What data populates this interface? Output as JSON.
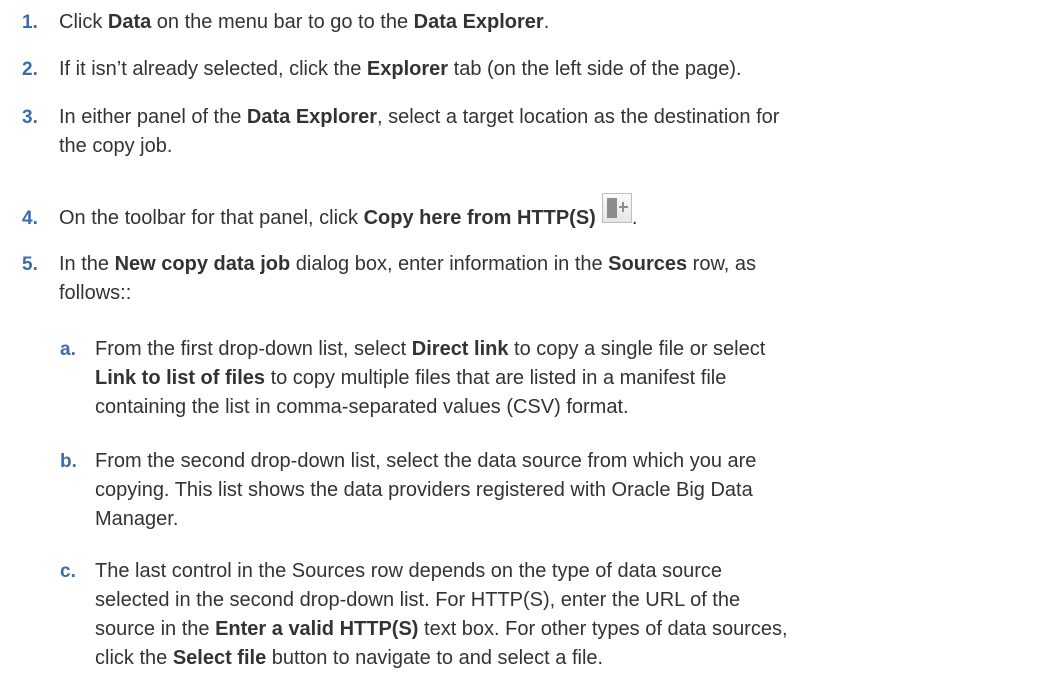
{
  "steps": [
    {
      "num": "1.",
      "parts": [
        "Click ",
        "Data",
        " on the menu bar to go to the ",
        "Data Explorer",
        "."
      ]
    },
    {
      "num": "2.",
      "parts": [
        "If it isn’t already selected, click the ",
        "Explorer",
        " tab (on the left side of the page)."
      ]
    },
    {
      "num": "3.",
      "lines": [
        [
          "In either panel of the ",
          "Data Explorer",
          ", select a target location as the destination for"
        ],
        [
          "the copy job."
        ]
      ]
    },
    {
      "num": "4.",
      "parts": [
        "On the toolbar for that panel, click ",
        "Copy here from HTTP(S)",
        "."
      ],
      "icon": "copy-here-from-http-icon"
    },
    {
      "num": "5.",
      "lines": [
        [
          "In the ",
          "New copy data job",
          " dialog box, enter information in the ",
          "Sources",
          " row, as"
        ],
        [
          "follows::"
        ]
      ]
    }
  ],
  "substeps": [
    {
      "num": "a.",
      "lines": [
        [
          "From the first drop-down list, select ",
          "Direct link",
          " to copy a single file or select"
        ],
        [
          "",
          "Link to list of files",
          " to copy multiple files that are listed in a manifest file"
        ],
        [
          "containing the list in comma-separated values (CSV) format."
        ]
      ]
    },
    {
      "num": "b.",
      "lines": [
        [
          "From the second drop-down list, select the data source from which you are"
        ],
        [
          "copying. This list shows the data providers registered with Oracle Big Data"
        ],
        [
          "Manager."
        ]
      ]
    },
    {
      "num": "c.",
      "lines": [
        [
          "The last control in the Sources row depends on the type of data source"
        ],
        [
          "selected in the second drop-down list. For HTTP(S), enter the URL of the"
        ],
        [
          "source in the ",
          "Enter a valid HTTP(S)",
          " text box. For other types of data sources,"
        ],
        [
          "click the ",
          "Select file",
          " button to navigate to and select a file."
        ]
      ]
    }
  ],
  "colors": {
    "number": "#3b6cad",
    "text": "#333333"
  }
}
